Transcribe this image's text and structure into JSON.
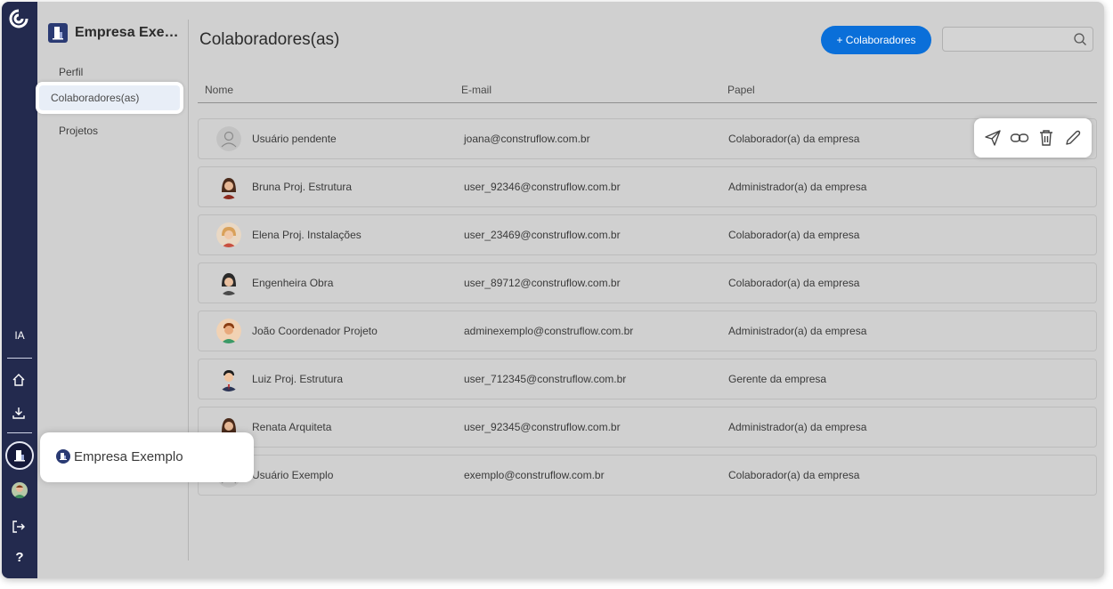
{
  "rail": {
    "ia_label": "IA",
    "help_label": "?"
  },
  "sidebar": {
    "company_name": "Empresa Exem...",
    "items": [
      {
        "label": "Perfil"
      },
      {
        "label": "Colaboradores(as)"
      },
      {
        "label": "Projetos"
      }
    ]
  },
  "header": {
    "title": "Colaboradores(as)",
    "add_button_label": "+ Colaboradores",
    "search_placeholder": ""
  },
  "table": {
    "columns": [
      "Nome",
      "E-mail",
      "Papel"
    ],
    "rows": [
      {
        "name": "Usuário pendente",
        "email": "joana@construflow.com.br",
        "role": "Colaborador(a) da empresa",
        "avatar": "placeholder"
      },
      {
        "name": "Bruna Proj. Estrutura",
        "email": "user_92346@construflow.com.br",
        "role": "Administrador(a) da empresa",
        "avatar": "woman-dark-hair"
      },
      {
        "name": "Elena Proj. Instalações",
        "email": "user_23469@construflow.com.br",
        "role": "Colaborador(a) da empresa",
        "avatar": "woman-blonde"
      },
      {
        "name": "Engenheira Obra",
        "email": "user_89712@construflow.com.br",
        "role": "Colaborador(a) da empresa",
        "avatar": "woman-black-hair"
      },
      {
        "name": "João Coordenador Projeto",
        "email": "adminexemplo@construflow.com.br",
        "role": "Administrador(a) da empresa",
        "avatar": "man-green-shirt"
      },
      {
        "name": "Luiz Proj. Estrutura",
        "email": "user_712345@construflow.com.br",
        "role": "Gerente da empresa",
        "avatar": "man-suit"
      },
      {
        "name": "Renata Arquiteta",
        "email": "user_92345@construflow.com.br",
        "role": "Administrador(a) da empresa",
        "avatar": "woman-dark-hair"
      },
      {
        "name": "Usuário Exemplo",
        "email": "exemplo@construflow.com.br",
        "role": "Colaborador(a) da empresa",
        "avatar": "placeholder"
      }
    ]
  },
  "row_actions": [
    "send-icon",
    "link-icon",
    "trash-icon",
    "pencil-icon"
  ],
  "tooltip": {
    "label": "Empresa Exemplo"
  },
  "colors": {
    "rail": "#232a4e",
    "accent": "#0a6fd9",
    "background": "#d0d0d0"
  }
}
